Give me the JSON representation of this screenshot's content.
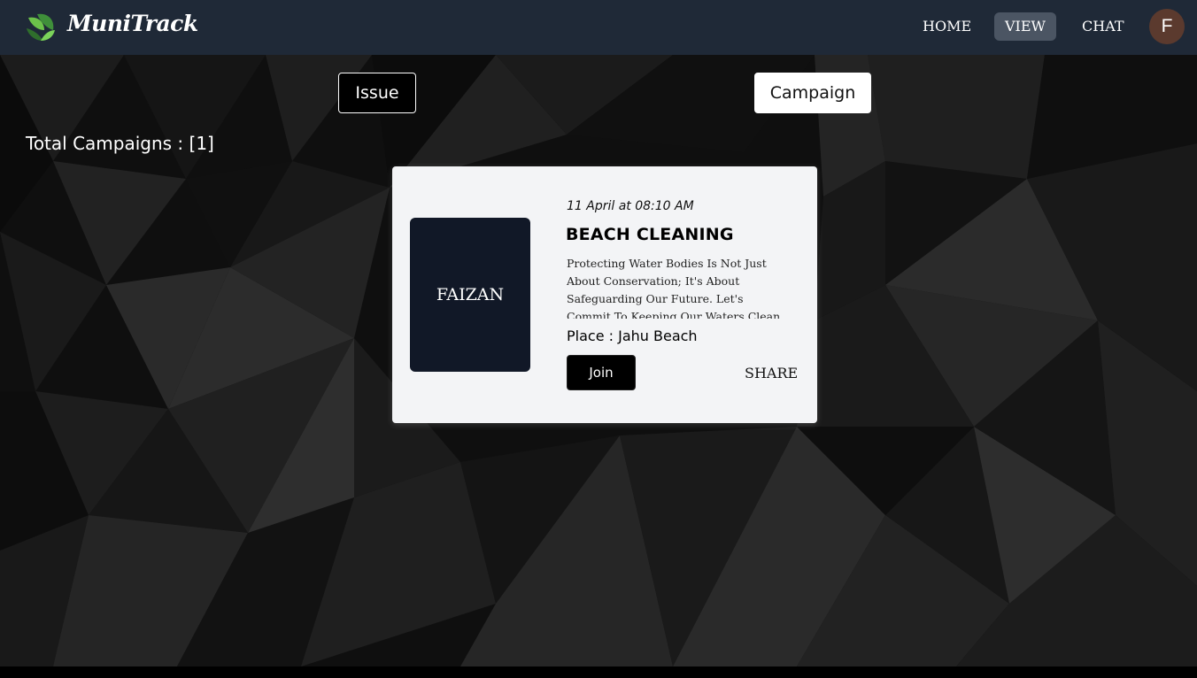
{
  "navbar": {
    "brand": "MuniTrack",
    "items": [
      {
        "label": "HOME"
      },
      {
        "label": "VIEW"
      },
      {
        "label": "CHAT"
      }
    ],
    "avatar_initial": "F"
  },
  "toggles": {
    "issue_label": "Issue",
    "campaign_label": "Campaign"
  },
  "summary": {
    "total_text": "Total Campaigns : [1]"
  },
  "campaigns": [
    {
      "image_label": "FAIZAN",
      "date": "11 April at 08:10 AM",
      "title": "BEACH CLEANING",
      "description": "Protecting Water Bodies Is Not Just About Conservation; It's About Safeguarding Our Future. Let's Commit To Keeping Our Waters Clean. For",
      "place": "Place : Jahu Beach",
      "join_label": "Join",
      "share_label": "SHARE"
    }
  ],
  "colors": {
    "navbar_bg": "#1f2937",
    "active_nav_bg": "#4b5563",
    "card_bg": "#f3f4f6",
    "card_image_bg": "#111827",
    "avatar_bg": "#5b3a2e"
  },
  "icons": {
    "logo": "leaf-logo-icon"
  }
}
